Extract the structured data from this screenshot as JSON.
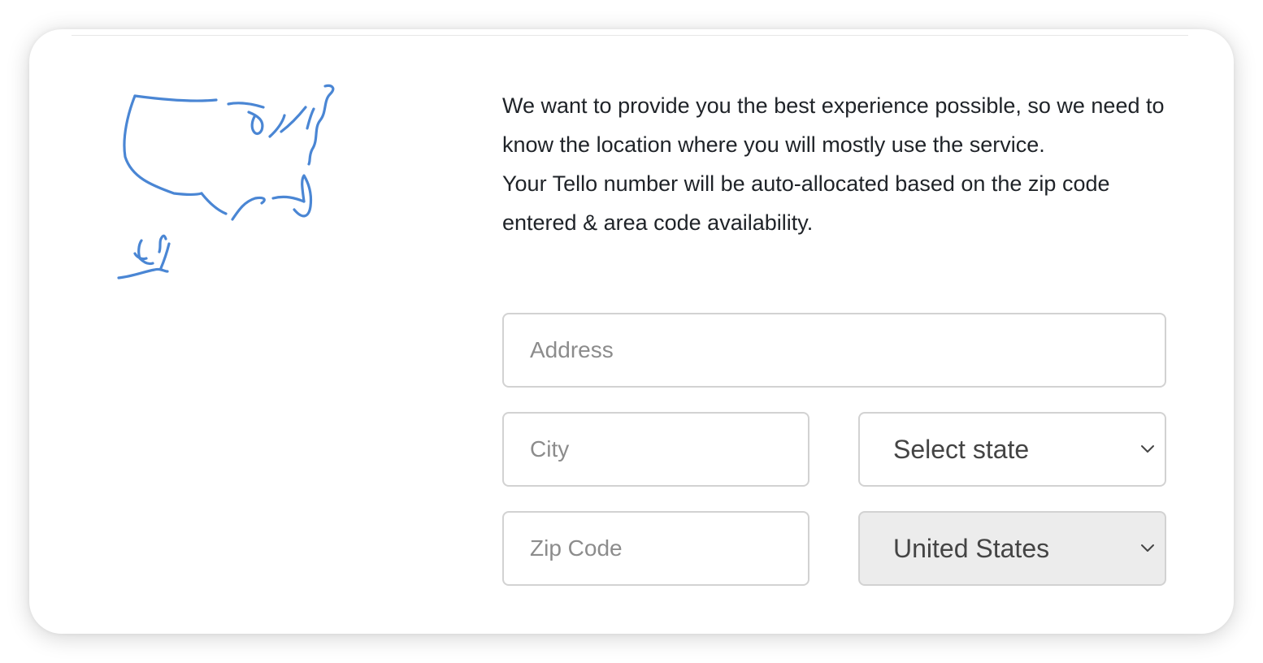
{
  "intro": {
    "line1": "We want to provide you the best experience possible, so we need to know the location where you will mostly use the service.",
    "line2": "Your Tello number will be auto-allocated based on the zip code entered & area code availability."
  },
  "form": {
    "address": {
      "placeholder": "Address",
      "value": ""
    },
    "city": {
      "placeholder": "City",
      "value": ""
    },
    "zip": {
      "placeholder": "Zip Code",
      "value": ""
    },
    "state": {
      "selected": "Select state"
    },
    "country": {
      "selected": "United States",
      "disabled": true
    }
  },
  "colors": {
    "map_stroke": "#4a86d4",
    "border": "#d2d2d2",
    "disabled_bg": "#ececec"
  },
  "icons": {
    "map": "usa-map-illustration",
    "dropdown": "chevron-down-icon"
  }
}
